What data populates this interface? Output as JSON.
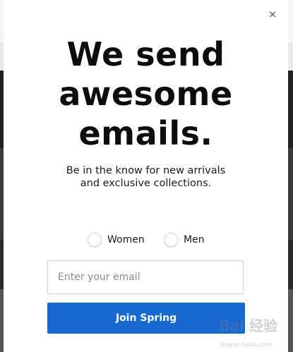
{
  "modal": {
    "close_glyph": "×",
    "headline_lines": [
      "We send",
      "awesome",
      "emails."
    ],
    "subtext_lines": [
      "Be in the know for new arrivals",
      "and exclusive collections."
    ],
    "gender_options": {
      "women": "Women",
      "men": "Men"
    },
    "email_placeholder": "Enter your email",
    "email_value": "",
    "submit_label": "Join Spring"
  },
  "watermark": {
    "text": "Bai 经验",
    "subtext": "jingyan.baidu.com"
  },
  "colors": {
    "button_bg": "#1669d1",
    "headline": "#0d0d0d",
    "modal_bg": "#ffffff"
  },
  "icons": {
    "close": "close-icon"
  }
}
